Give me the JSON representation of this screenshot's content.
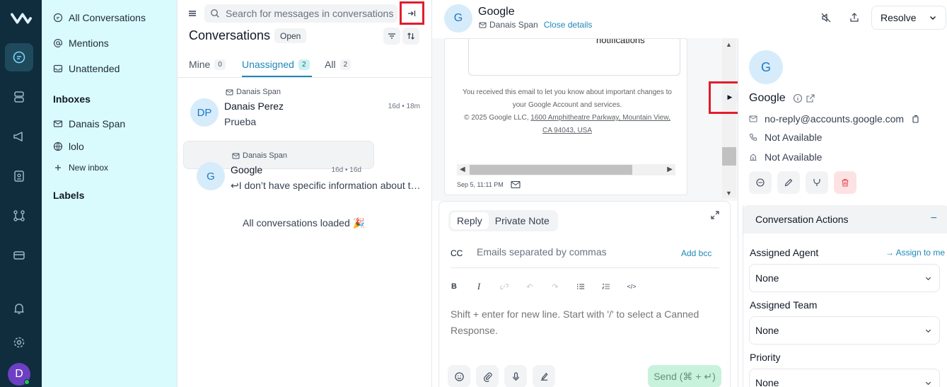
{
  "nav": {
    "items": [
      {
        "icon": "conversations-icon",
        "active": true
      },
      {
        "icon": "contacts-icon",
        "active": false
      },
      {
        "icon": "campaigns-megaphone-icon",
        "active": false
      },
      {
        "icon": "reports-icon",
        "active": false
      },
      {
        "icon": "automation-flow-icon",
        "active": false
      },
      {
        "icon": "billing-card-icon",
        "active": false
      }
    ],
    "user_initial": "D"
  },
  "sidebar": {
    "items": [
      {
        "label": "All Conversations",
        "icon": "chat-bubble-icon"
      },
      {
        "label": "Mentions",
        "icon": "at-sign-icon"
      },
      {
        "label": "Unattended",
        "icon": "inbox-icon"
      }
    ],
    "inboxes_heading": "Inboxes",
    "inboxes": [
      {
        "label": "Danais Span",
        "icon": "mail-icon"
      },
      {
        "label": "lolo",
        "icon": "globe-icon"
      }
    ],
    "new_inbox_label": "New inbox",
    "labels_heading": "Labels"
  },
  "list": {
    "search_placeholder": "Search for messages in conversations",
    "title": "Conversations",
    "status": "Open",
    "tabs": [
      {
        "label": "Mine",
        "count": "0"
      },
      {
        "label": "Unassigned",
        "count": "2"
      },
      {
        "label": "All",
        "count": "2"
      }
    ],
    "conversations": [
      {
        "inbox": "Danais Span",
        "initials": "DP",
        "name": "Danais Perez",
        "time": "16d • 18m",
        "message": "Prueba"
      },
      {
        "inbox": "Danais Span",
        "initials": "G",
        "name": "Google",
        "time": "16d • 16d",
        "message": "I don’t have specific information about the st..."
      }
    ],
    "loaded_text": "All conversations loaded 🎉"
  },
  "pane": {
    "contact_initial": "G",
    "contact_name": "Google",
    "inbox": "Danais Span",
    "close_details": "Close details",
    "resolve_label": "Resolve",
    "email_notifications": "notifications",
    "email_footer_1": "You received this email to let you know about important changes to",
    "email_footer_2": "your Google Account and services.",
    "email_footer_3": "© 2025 Google LLC, ",
    "email_footer_addr_1": "1600 Amphitheatre Parkway, Mountain View,",
    "email_footer_addr_2": "CA 94043, USA",
    "msg_time": "Sep 5, 11:11 PM",
    "reply_tab": "Reply",
    "private_note_tab": "Private Note",
    "cc_label": "CC",
    "cc_placeholder": "Emails separated by commas",
    "add_bcc": "Add bcc",
    "editor_placeholder": "Shift + enter for new line. Start with '/' to select a Canned Response.",
    "send_label": "Send (⌘ + ↵)"
  },
  "contact": {
    "initial": "G",
    "name": "Google",
    "email": "no-reply@accounts.google.com",
    "phone": "Not Available",
    "company": "Not Available",
    "actions_title": "Conversation Actions",
    "assigned_agent_label": "Assigned Agent",
    "assign_to_me": "Assign to me",
    "assigned_agent_value": "None",
    "assigned_team_label": "Assigned Team",
    "assigned_team_value": "None",
    "priority_label": "Priority",
    "priority_value": "None"
  },
  "colors": {
    "rail": "#0f2d3d",
    "sidebar": "#d9fbfd",
    "accent": "#1e88b8",
    "highlight": "#e11d2e",
    "send": "#c8f2dc"
  }
}
